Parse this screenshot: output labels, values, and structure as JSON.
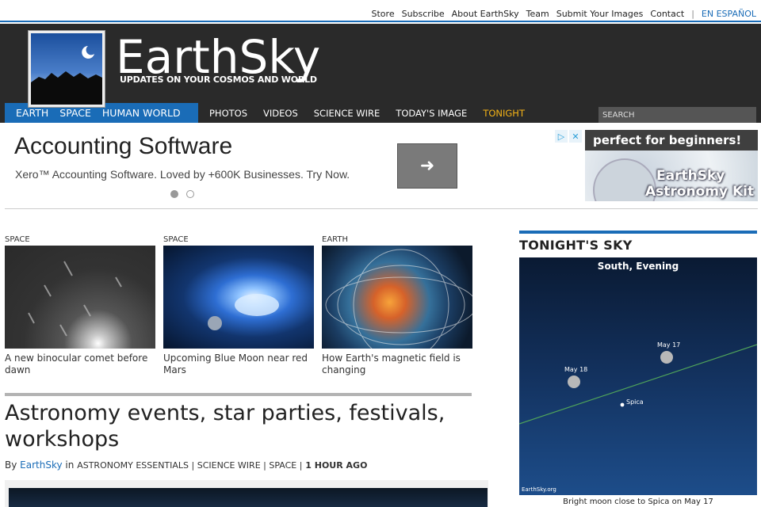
{
  "utility": {
    "links": [
      "Store",
      "Subscribe",
      "About EarthSky",
      "Team",
      "Submit Your Images",
      "Contact"
    ],
    "language": "EN ESPAÑOL"
  },
  "brand": {
    "name": "EarthSky",
    "tagline": "UPDATES ON YOUR COSMOS AND WORLD"
  },
  "nav": {
    "primary": [
      "EARTH",
      "SPACE",
      "HUMAN WORLD"
    ],
    "secondary": [
      "PHOTOS",
      "VIDEOS",
      "SCIENCE WIRE",
      "TODAY'S IMAGE"
    ],
    "tonight": "TONIGHT",
    "search_placeholder": "SEARCH"
  },
  "ad": {
    "title": "Accounting Software",
    "description": "Xero™ Accounting Software. Loved by +600K Businesses. Try Now.",
    "button_icon": "arrow-right-icon",
    "kit_top": "perfect for beginners!",
    "kit_line1": "EarthSky",
    "kit_line2": "Astronomy Kit"
  },
  "stories": [
    {
      "category": "SPACE",
      "title": "A new binocular comet before dawn"
    },
    {
      "category": "SPACE",
      "title": "Upcoming Blue Moon near red Mars"
    },
    {
      "category": "EARTH",
      "title": "How Earth's magnetic field is changing"
    }
  ],
  "article": {
    "headline": "Astronomy events, star parties, festivals, workshops",
    "by": "By",
    "author": "EarthSky",
    "in": "in",
    "categories": "ASTRONOMY ESSENTIALS | SCIENCE WIRE | SPACE |",
    "time": "1 HOUR AGO"
  },
  "tonight": {
    "heading": "TONIGHT'S SKY",
    "sky_label": "South, Evening",
    "markers": [
      "May 17",
      "May 18",
      "Spica"
    ],
    "credit": "EarthSky.org",
    "caption": "Bright moon close to Spica on May 17"
  },
  "colors": {
    "accent": "#1a6cb7",
    "header_bg": "#2a2a2a",
    "tonight": "#f5b316"
  }
}
